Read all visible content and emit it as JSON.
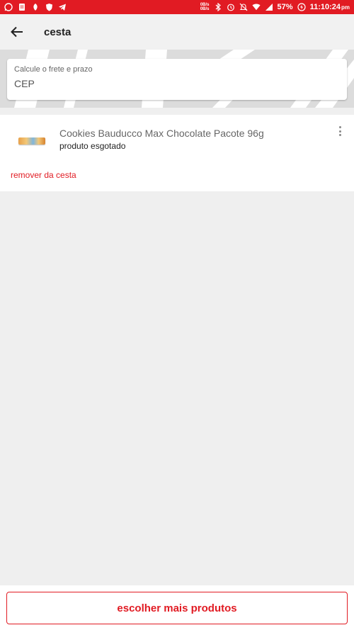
{
  "status_bar": {
    "speed_up": "0B/s",
    "speed_down": "0B/s",
    "battery": "57%",
    "time": "11:10:24",
    "time_suffix": "pm",
    "left_icons": [
      "whatsapp-icon",
      "document-icon",
      "leaf-icon",
      "shield-icon",
      "telegram-icon"
    ],
    "right_icons": [
      "bluetooth-icon",
      "alarm-icon",
      "mute-icon",
      "wifi-icon",
      "signal-icon",
      "battery-icon"
    ]
  },
  "header": {
    "title": "cesta",
    "back_icon": "arrow-left-icon"
  },
  "shipping": {
    "label": "Calcule o frete e prazo",
    "placeholder": "CEP"
  },
  "cart": {
    "items": [
      {
        "name": "Cookies Bauducco Max Chocolate Pacote 96g",
        "status": "produto esgotado",
        "remove_label": "remover da cesta"
      }
    ]
  },
  "footer": {
    "cta_label": "escolher mais produtos"
  },
  "colors": {
    "accent": "#e11b23",
    "background": "#efefef",
    "card": "#ffffff"
  }
}
